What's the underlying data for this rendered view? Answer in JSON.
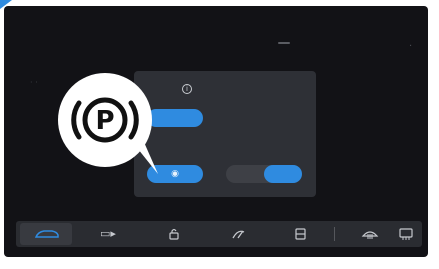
{
  "screen": {
    "side_mark": "· ·",
    "info_glyph": "i"
  },
  "callout": {
    "parking_letter": "P"
  },
  "bottom_bar": {
    "items": [
      {
        "name": "car-icon",
        "glyph": "",
        "selected": true
      },
      {
        "name": "trunk-icon",
        "glyph": "▭▸"
      },
      {
        "name": "lock-icon",
        "glyph": "🔓︎"
      },
      {
        "name": "wiper-icon",
        "glyph": "✎"
      },
      {
        "name": "door-icon",
        "glyph": "⊟"
      },
      {
        "name": "front-defrost-icon",
        "glyph": "⌓"
      },
      {
        "name": "rear-defrost-icon",
        "glyph": "⌸"
      }
    ]
  },
  "colors": {
    "accent": "#2f8be0",
    "screen_bg": "#121216",
    "card_bg": "#2e3036",
    "bar_bg": "#2a2c31"
  }
}
